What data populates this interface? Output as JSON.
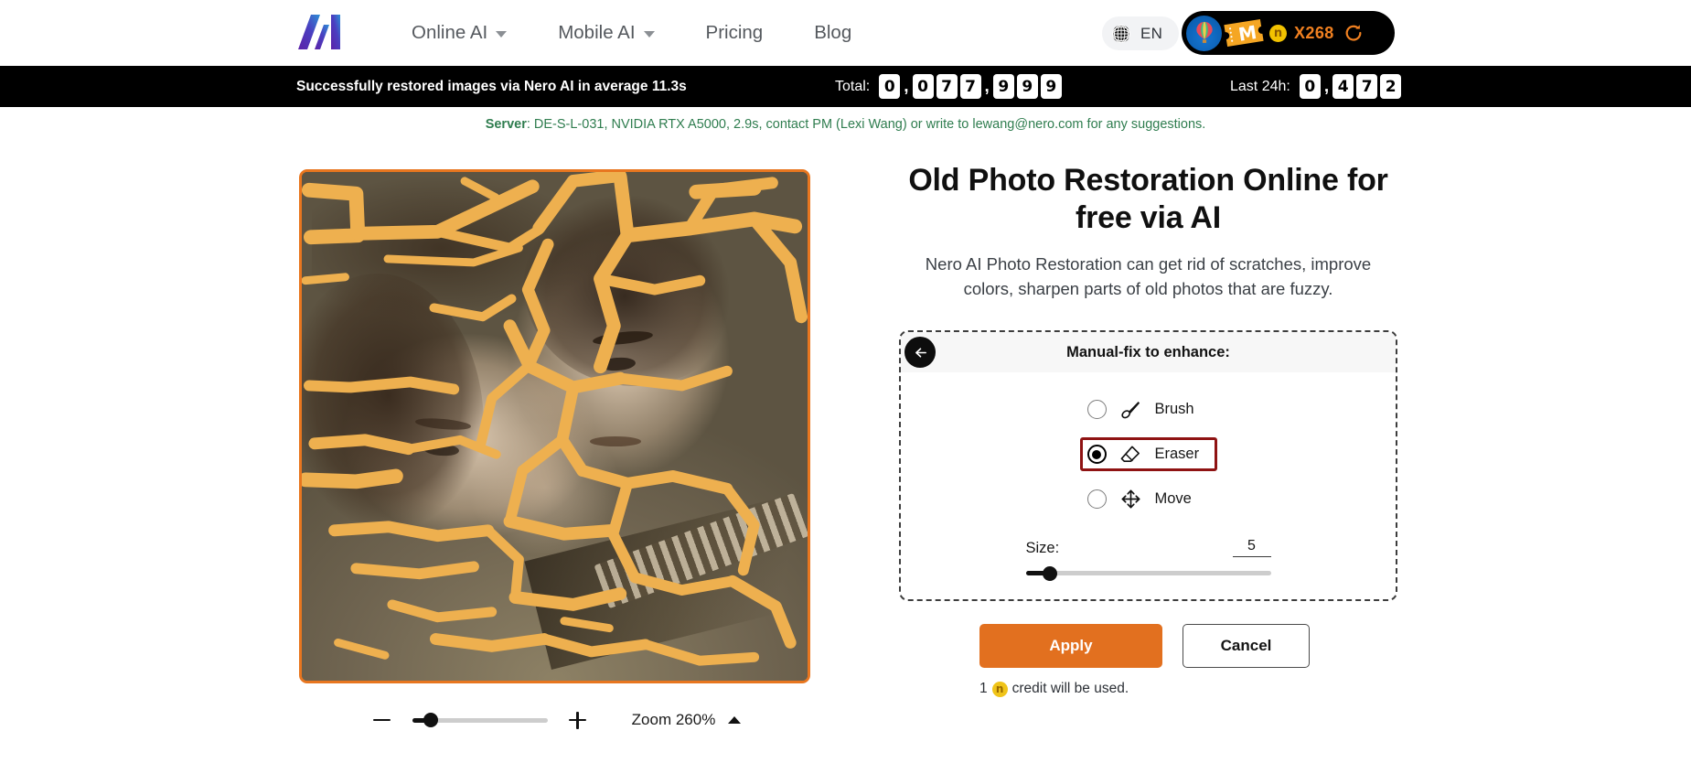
{
  "header": {
    "logo_alt": "Nero AI logo",
    "nav": [
      {
        "label": "Online AI",
        "has_dropdown": true
      },
      {
        "label": "Mobile AI",
        "has_dropdown": true
      },
      {
        "label": "Pricing",
        "has_dropdown": false
      },
      {
        "label": "Blog",
        "has_dropdown": false
      }
    ],
    "language": {
      "icon": "globe-icon",
      "label": "EN"
    },
    "promo": {
      "ticket_letter": "M",
      "coin_letter": "n",
      "count": "X268",
      "refresh_icon": "refresh-icon"
    }
  },
  "stats_bar": {
    "message": "Successfully restored images via Nero AI in average 11.3s",
    "total": {
      "label": "Total:",
      "digits": [
        "0",
        ",",
        "0",
        "7",
        "7",
        ",",
        "9",
        "9",
        "9"
      ]
    },
    "last_24h": {
      "label": "Last 24h:",
      "digits": [
        "0",
        ",",
        "4",
        "7",
        "2"
      ]
    }
  },
  "server_line": {
    "prefix": "Server",
    "text": ": DE-S-L-031, NVIDIA RTX A5000, 2.9s, contact PM (Lexi Wang) or write to lewang@nero.com for any suggestions.",
    "color": "#2f7d4f"
  },
  "canvas": {
    "border_color": "#e8761f",
    "mask_color": "#eeb04f",
    "description": "Sepia vintage portrait of a woman and a uniformed man with orange mask strokes over scratches"
  },
  "zoom_control": {
    "minus_icon": "minus-icon",
    "plus_icon": "plus-icon",
    "label": "Zoom 260%",
    "value_percent": 260,
    "slider_percent": 10,
    "chevron_icon": "chevron-up-icon"
  },
  "right_panel": {
    "title": "Old Photo Restoration Online for free via AI",
    "subtitle": "Nero AI Photo Restoration can get rid of scratches, improve colors, sharpen parts of old photos that are fuzzy.",
    "fix_panel": {
      "back_icon": "arrow-left-icon",
      "heading": "Manual-fix to enhance:",
      "tools": [
        {
          "label": "Brush",
          "icon": "brush-icon",
          "selected": false
        },
        {
          "label": "Eraser",
          "icon": "eraser-icon",
          "selected": true
        },
        {
          "label": "Move",
          "icon": "move-icon",
          "selected": false
        }
      ],
      "selected_highlight_color": "#8f1313",
      "size": {
        "label": "Size:",
        "value": "5",
        "slider_percent": 9
      }
    },
    "actions": {
      "apply_label": "Apply",
      "apply_color": "#e2701f",
      "cancel_label": "Cancel"
    },
    "credit_note": {
      "amount": "1",
      "coin_letter": "n",
      "text": "credit will be used."
    }
  }
}
